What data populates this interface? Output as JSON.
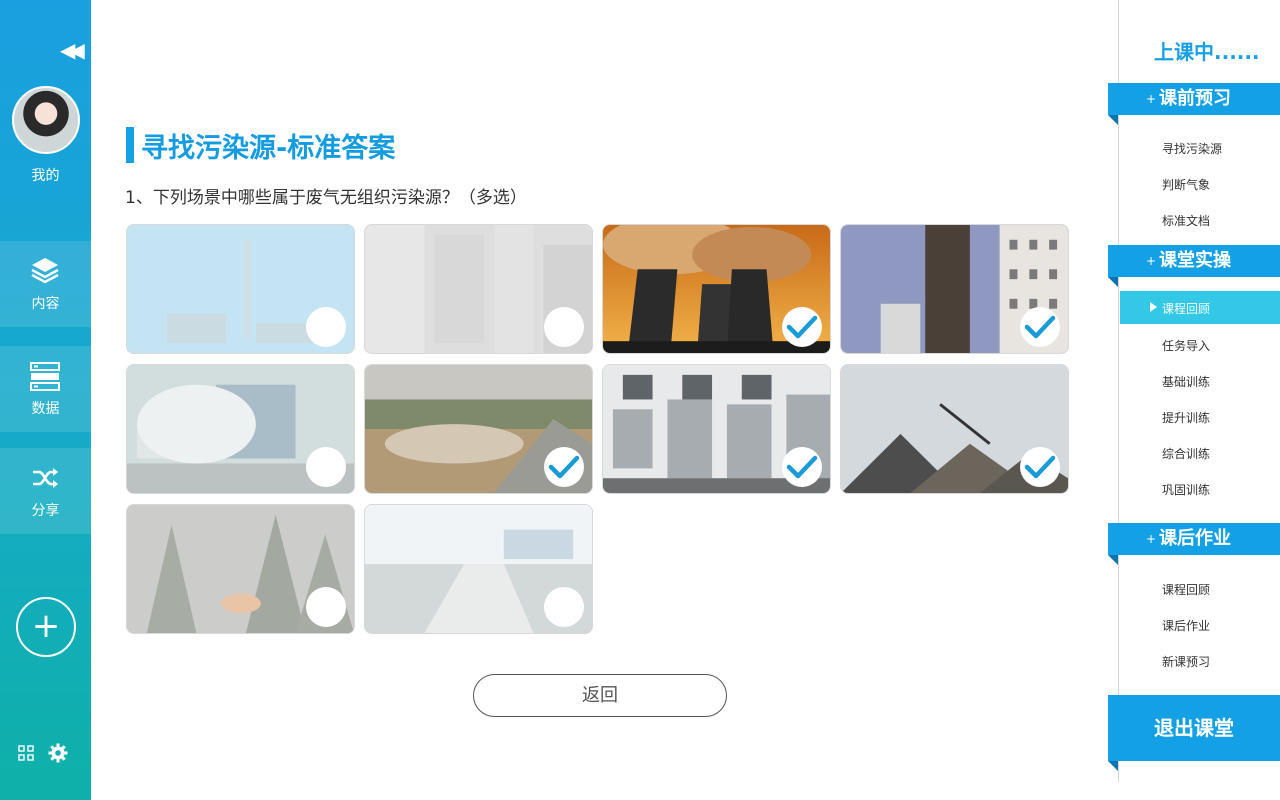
{
  "sidebar": {
    "profile_label": "我的",
    "nav": [
      {
        "label": "内容",
        "icon": "layers-icon"
      },
      {
        "label": "数据",
        "icon": "database-icon"
      },
      {
        "label": "分享",
        "icon": "shuffle-icon"
      }
    ],
    "add_symbol": "+",
    "collapse_symbol": "◀◀"
  },
  "main": {
    "title": "寻找污染源-标准答案",
    "question": "1、下列场景中哪些属于废气无组织污染源？（多选）",
    "return_label": "返回",
    "options": [
      {
        "scene": "chimney-haze",
        "correct": false
      },
      {
        "scene": "industrial-ducts",
        "correct": false
      },
      {
        "scene": "cooling-towers",
        "correct": true
      },
      {
        "scene": "steel-tower-building",
        "correct": true
      },
      {
        "scene": "truck-dust-road",
        "correct": false
      },
      {
        "scene": "dusty-construction-site",
        "correct": true
      },
      {
        "scene": "factory-ducting",
        "correct": true
      },
      {
        "scene": "gravel-piles-conveyor",
        "correct": true
      },
      {
        "scene": "forest-fire-smoke",
        "correct": false
      },
      {
        "scene": "sewage-treatment-plant",
        "correct": false
      }
    ]
  },
  "right_panel": {
    "status": "上课中......",
    "sections": [
      {
        "title": "课前预习",
        "plus": "+",
        "items": [
          "寻找污染源",
          "判断气象",
          "标准文档"
        ]
      },
      {
        "title": "课堂实操",
        "plus": "+",
        "items": [
          "课程回顾",
          "任务导入",
          "基础训练",
          "提升训练",
          "综合训练",
          "巩固训练"
        ],
        "active": "课程回顾"
      },
      {
        "title": "课后作业",
        "plus": "+",
        "items": [
          "课程回顾",
          "课后作业",
          "新课预习"
        ]
      }
    ],
    "exit_label": "退出课堂"
  },
  "colors": {
    "accent": "#14a0e4",
    "active_item": "#33c8e6",
    "check": "#1a9ad6"
  }
}
